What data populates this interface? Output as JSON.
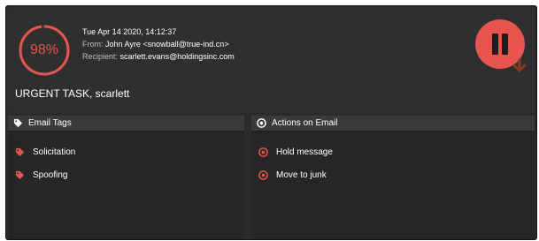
{
  "score": {
    "value": 98,
    "label": "98%",
    "color": "#e8554e"
  },
  "email": {
    "date": "Tue Apr 14 2020, 14:12:37",
    "from_label": "From:",
    "from_value": "John Ayre <snowball@true-ind.cn>",
    "recipient_label": "Recipient:",
    "recipient_value": "scarlett.evans@holdingsinc.com",
    "subject": "URGENT TASK, scarlett"
  },
  "controls": {
    "pause_icon": "pause-icon",
    "expand_icon": "chevron-down-icon"
  },
  "tags_panel": {
    "title": "Email Tags",
    "icon": "tags-icon",
    "items": [
      {
        "label": "Solicitation",
        "icon": "tag-icon"
      },
      {
        "label": "Spoofing",
        "icon": "tag-icon"
      }
    ]
  },
  "actions_panel": {
    "title": "Actions on Email",
    "icon": "target-icon",
    "items": [
      {
        "label": "Hold message",
        "icon": "target-icon"
      },
      {
        "label": "Move to junk",
        "icon": "target-icon"
      }
    ]
  },
  "colors": {
    "accent": "#e8554e",
    "background": "#2b2b2b",
    "panel": "#262626",
    "panel_header": "#3a3a3a",
    "chevron": "#8a3b1e"
  }
}
